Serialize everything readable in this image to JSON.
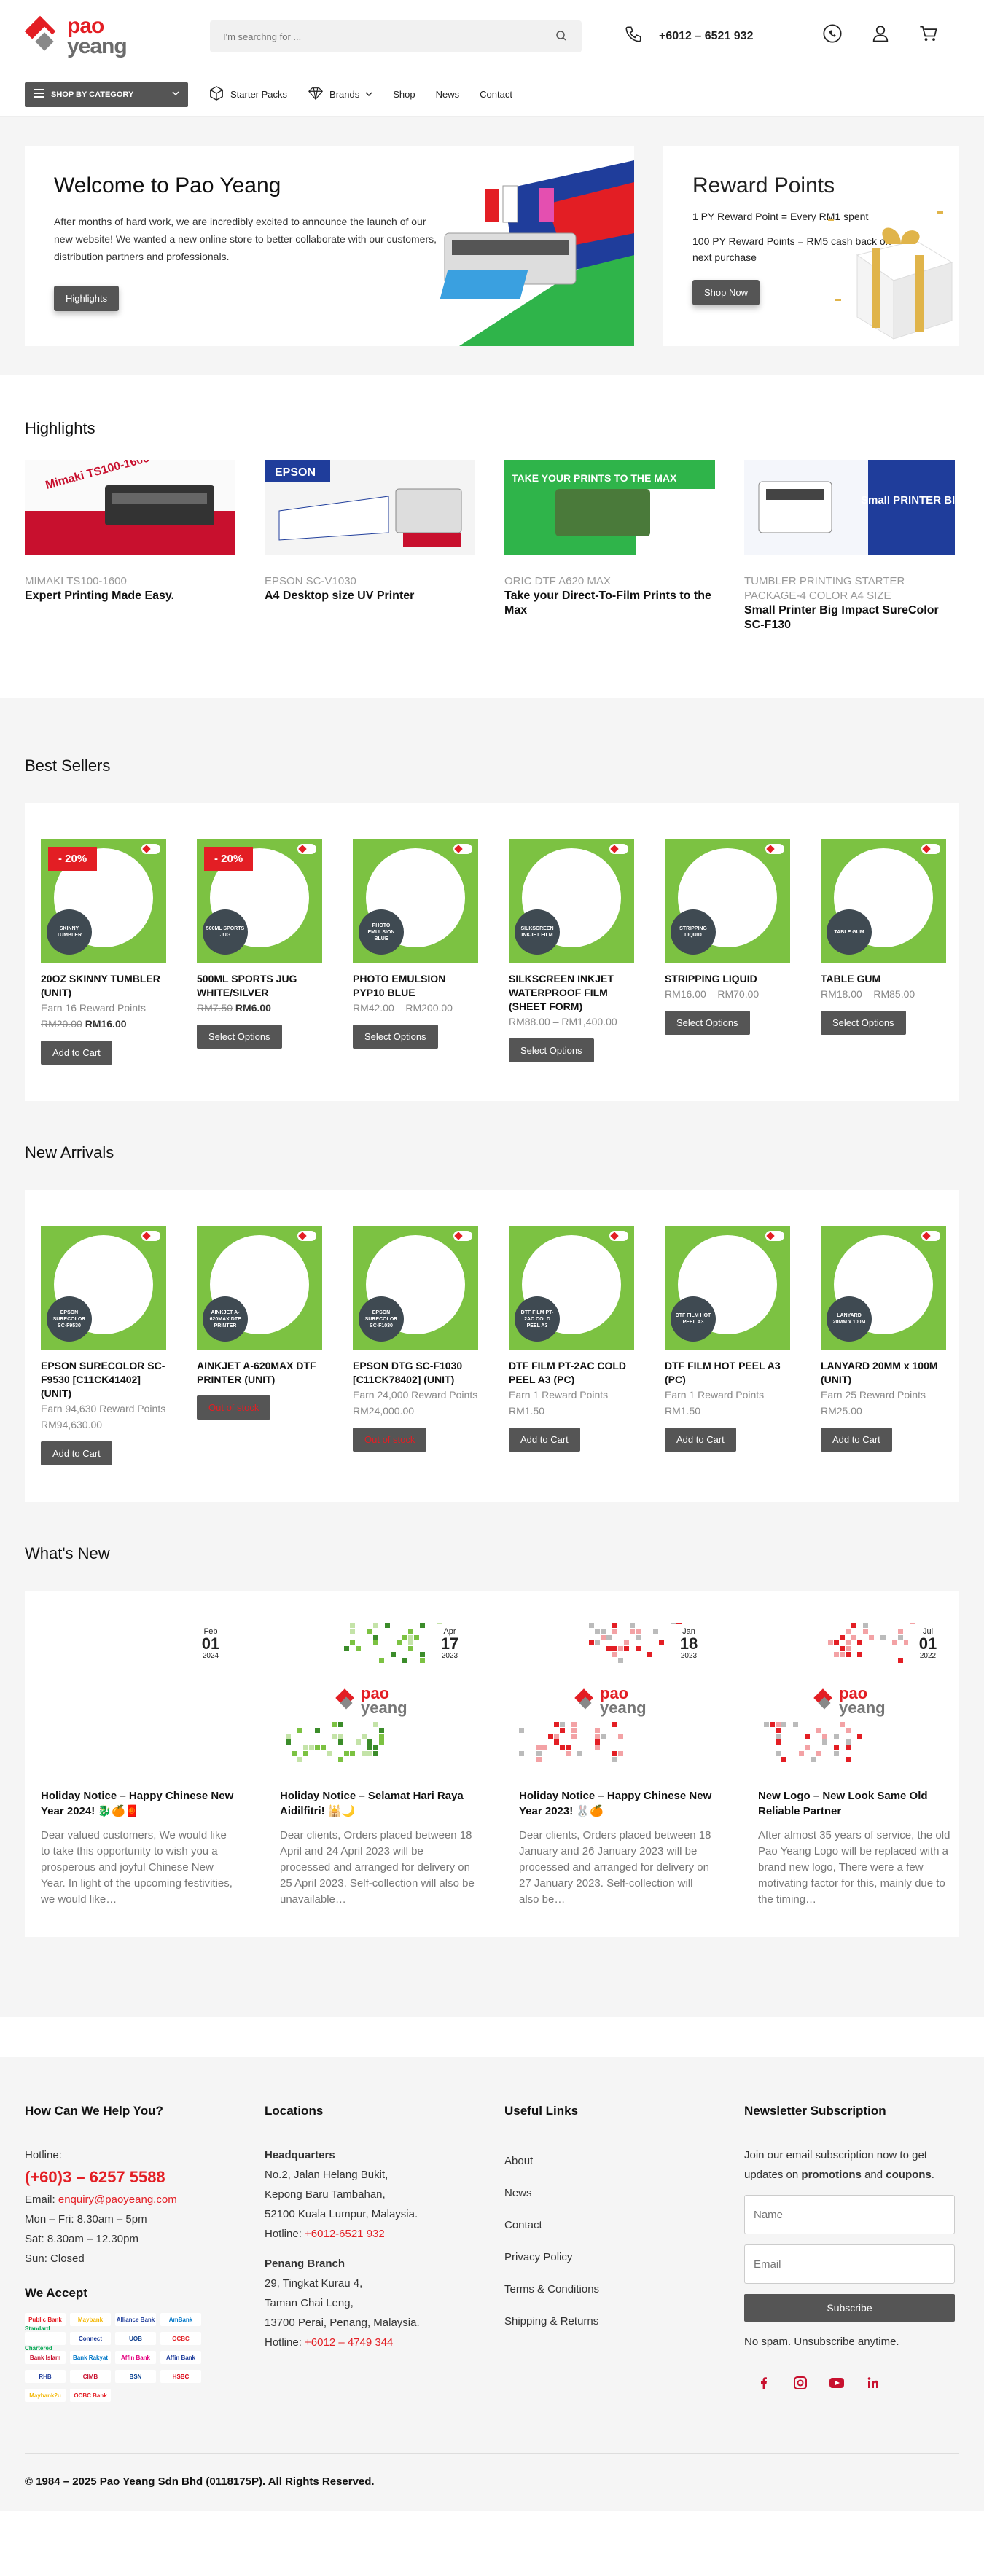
{
  "header": {
    "logo_line1": "pao",
    "logo_line2": "yeang",
    "search_placeholder": "I'm searchng for ...",
    "phone": "+6012 – 6521 932"
  },
  "nav": {
    "category_button": "SHOP BY CATEGORY",
    "items": [
      "Starter Packs",
      "Brands",
      "Shop",
      "News",
      "Contact"
    ]
  },
  "hero": {
    "welcome_title": "Welcome to Pao Yeang",
    "welcome_text": "After months of hard work, we are incredibly excited to announce the launch of our new website! We wanted a new online store to better collaborate with our customers, distribution partners and professionals.",
    "welcome_button": "Highlights",
    "reward_title": "Reward Points",
    "reward_line1": "1 PY Reward Point = Every RM1 spent",
    "reward_line2": "100 PY Reward Points = RM5 cash back on next purchase",
    "reward_button": "Shop Now"
  },
  "highlights": {
    "title": "Highlights",
    "items": [
      {
        "sub": "MIMAKI TS100-1600",
        "title": "Expert Printing Made Easy.",
        "img_text": "Mimaki TS100-1600"
      },
      {
        "sub": "EPSON SC-V1030",
        "title": "A4 Desktop size UV Printer",
        "img_text": "EPSON"
      },
      {
        "sub": "ORIC DTF A620 MAX",
        "title": "Take your Direct-To-Film Prints to the Max",
        "img_text": "TAKE YOUR PRINTS TO THE MAX"
      },
      {
        "sub": "TUMBLER PRINTING STARTER PACKAGE-4 COLOR A4 SIZE",
        "title": "Small Printer Big Impact SureColor SC-F130",
        "img_text": "Small PRINTER BIG impact"
      }
    ]
  },
  "best_sellers": {
    "title": "Best Sellers",
    "products": [
      {
        "name": "20OZ SKINNY TUMBLER (UNIT)",
        "info": "Earn 16 Reward Points",
        "old": "RM20.00",
        "price": "RM16.00",
        "range": "",
        "button": "Add to Cart",
        "sale": "- 20%",
        "tag": "SKINNY TUMBLER"
      },
      {
        "name": "500ML SPORTS JUG WHITE/SILVER",
        "info": "",
        "old": "RM7.50",
        "price": "RM6.00",
        "range": "",
        "button": "Select Options",
        "sale": "- 20%",
        "tag": "500ML SPORTS JUG"
      },
      {
        "name": "PHOTO EMULSION PYP10 BLUE",
        "info": "",
        "old": "",
        "price": "",
        "range": "RM42.00 – RM200.00",
        "button": "Select Options",
        "sale": "",
        "tag": "PHOTO EMULSION BLUE"
      },
      {
        "name": "SILKSCREEN INKJET WATERPROOF FILM (SHEET FORM)",
        "info": "",
        "old": "",
        "price": "",
        "range": "RM88.00 – RM1,400.00",
        "button": "Select Options",
        "sale": "",
        "tag": "SILKSCREEN INKJET FILM"
      },
      {
        "name": "STRIPPING LIQUID",
        "info": "",
        "old": "",
        "price": "",
        "range": "RM16.00 – RM70.00",
        "button": "Select Options",
        "sale": "",
        "tag": "STRIPPING LIQUID"
      },
      {
        "name": "TABLE GUM",
        "info": "",
        "old": "",
        "price": "",
        "range": "RM18.00 – RM85.00",
        "button": "Select Options",
        "sale": "",
        "tag": "TABLE GUM"
      }
    ]
  },
  "new_arrivals": {
    "title": "New Arrivals",
    "products": [
      {
        "name": "EPSON SURECOLOR SC-F9530 [C11CK41402] (UNIT)",
        "info": "Earn 94,630 Reward Points",
        "old": "",
        "price": "",
        "range": "RM94,630.00",
        "button": "Add to Cart",
        "oos": false,
        "tag": "EPSON SURECOLOR SC-F9530"
      },
      {
        "name": "AINKJET A-620MAX DTF PRINTER (UNIT)",
        "info": "",
        "old": "",
        "price": "",
        "range": "",
        "button": "Out of stock",
        "oos": true,
        "tag": "AINKJET A-620MAX DTF PRINTER"
      },
      {
        "name": "EPSON DTG SC-F1030 [C11CK78402] (UNIT)",
        "info": "Earn 24,000 Reward Points",
        "old": "",
        "price": "",
        "range": "RM24,000.00",
        "button": "Out of stock",
        "oos": true,
        "tag": "EPSON SURECOLOR SC-F1030"
      },
      {
        "name": "DTF FILM PT-2AC COLD PEEL A3 (PC)",
        "info": "Earn 1 Reward Points",
        "old": "",
        "price": "",
        "range": "RM1.50",
        "button": "Add to Cart",
        "oos": false,
        "tag": "DTF FILM PT-2AC COLD PEEL A3"
      },
      {
        "name": "DTF FILM HOT PEEL A3 (PC)",
        "info": "Earn 1 Reward Points",
        "old": "",
        "price": "",
        "range": "RM1.50",
        "button": "Add to Cart",
        "oos": false,
        "tag": "DTF FILM HOT PEEL A3"
      },
      {
        "name": "LANYARD 20MM x 100M (UNIT)",
        "info": "Earn 25 Reward Points",
        "old": "",
        "price": "",
        "range": "RM25.00",
        "button": "Add to Cart",
        "oos": false,
        "tag": "LANYARD 20MM x 100M"
      }
    ]
  },
  "whats_new": {
    "title": "What's New",
    "posts": [
      {
        "month": "Feb",
        "day": "01",
        "year": "2024",
        "title": "Holiday Notice – Happy Chinese New Year 2024! 🐉🍊🧧",
        "excerpt": "Dear valued customers, We would like to take this opportunity to wish you a prosperous and joyful Chinese New Year. In light of the upcoming festivities, we would like…",
        "logo": false,
        "logo_a": "",
        "logo_b": ""
      },
      {
        "month": "Apr",
        "day": "17",
        "year": "2023",
        "title": "Holiday Notice – Selamat Hari Raya Aidilfitri! 🕌🌙",
        "excerpt": "Dear clients, Orders placed between 18 April and 24 April 2023 will be processed and arranged for delivery on 25 April 2023. Self-collection will also be unavailable…",
        "logo": true,
        "logo_a": "pao",
        "logo_b": "yeang"
      },
      {
        "month": "Jan",
        "day": "18",
        "year": "2023",
        "title": "Holiday Notice – Happy Chinese New Year 2023! 🐰🍊",
        "excerpt": "Dear clients, Orders placed between 18 January and 26 January 2023 will be processed and arranged for delivery on 27 January 2023. Self-collection will also be…",
        "logo": true,
        "logo_a": "pao",
        "logo_b": "yeang"
      },
      {
        "month": "Jul",
        "day": "01",
        "year": "2022",
        "title": "New Logo – New Look Same Old Reliable Partner",
        "excerpt": "After almost 35 years of service, the old Pao Yeang Logo will be replaced with a brand new logo, There were a few motivating factor for this, mainly due to the timing…",
        "logo": true,
        "logo_a": "pao",
        "logo_b": "yeang"
      }
    ]
  },
  "footer": {
    "help_title": "How Can We Help You?",
    "hotline_label": "Hotline:",
    "hotline": "(+60)3 – 6257 5588",
    "email_label": "Email:",
    "email": "enquiry@paoyeang.com",
    "hours1": "Mon – Fri: 8.30am – 5pm",
    "hours2": "Sat: 8.30am – 12.30pm",
    "hours3": "Sun: Closed",
    "accept_title": "We Accept",
    "payments": [
      "Public Bank",
      "Maybank",
      "Alliance Bank",
      "AmBank",
      "Standard Chartered",
      "Connect",
      "UOB",
      "OCBC",
      "Bank Islam",
      "Bank Rakyat",
      "Affin Bank",
      "Affin Bank",
      "RHB",
      "CIMB",
      "BSN",
      "HSBC",
      "Maybank2u",
      "OCBC Bank"
    ],
    "locations_title": "Locations",
    "hq_label": "Headquarters",
    "hq_addr1": "No.2, Jalan Helang Bukit,",
    "hq_addr2": "Kepong Baru Tambahan,",
    "hq_addr3": "52100 Kuala Lumpur, Malaysia.",
    "hq_hotline_label": "Hotline:",
    "hq_hotline": "+6012-6521 932",
    "pg_label": "Penang Branch",
    "pg_addr1": "29, Tingkat Kurau 4,",
    "pg_addr2": "Taman Chai Leng,",
    "pg_addr3": "13700 Perai, Penang, Malaysia.",
    "pg_hotline_label": "Hotline:",
    "pg_hotline": "+6012 – 4749 344",
    "links_title": "Useful Links",
    "links": [
      "About",
      "News",
      "Contact",
      "Privacy Policy",
      "Terms & Conditions",
      "Shipping & Returns"
    ],
    "newsletter_title": "Newsletter Subscription",
    "newsletter_text1": "Join our email subscription now to get updates on",
    "newsletter_bold1": "promotions",
    "newsletter_and": "and",
    "newsletter_bold2": "coupons",
    "newsletter_dot": ".",
    "name_placeholder": "Name",
    "email_placeholder": "Email",
    "subscribe": "Subscribe",
    "spam": "No spam. Unsubscribe anytime.",
    "copyright": "© 1984 – 2025 Pao Yeang Sdn Bhd (0118175P). All Rights Reserved."
  },
  "colors": {
    "brand_red": "#e31e24",
    "brand_grey": "#555555",
    "product_green": "#7cc242"
  }
}
